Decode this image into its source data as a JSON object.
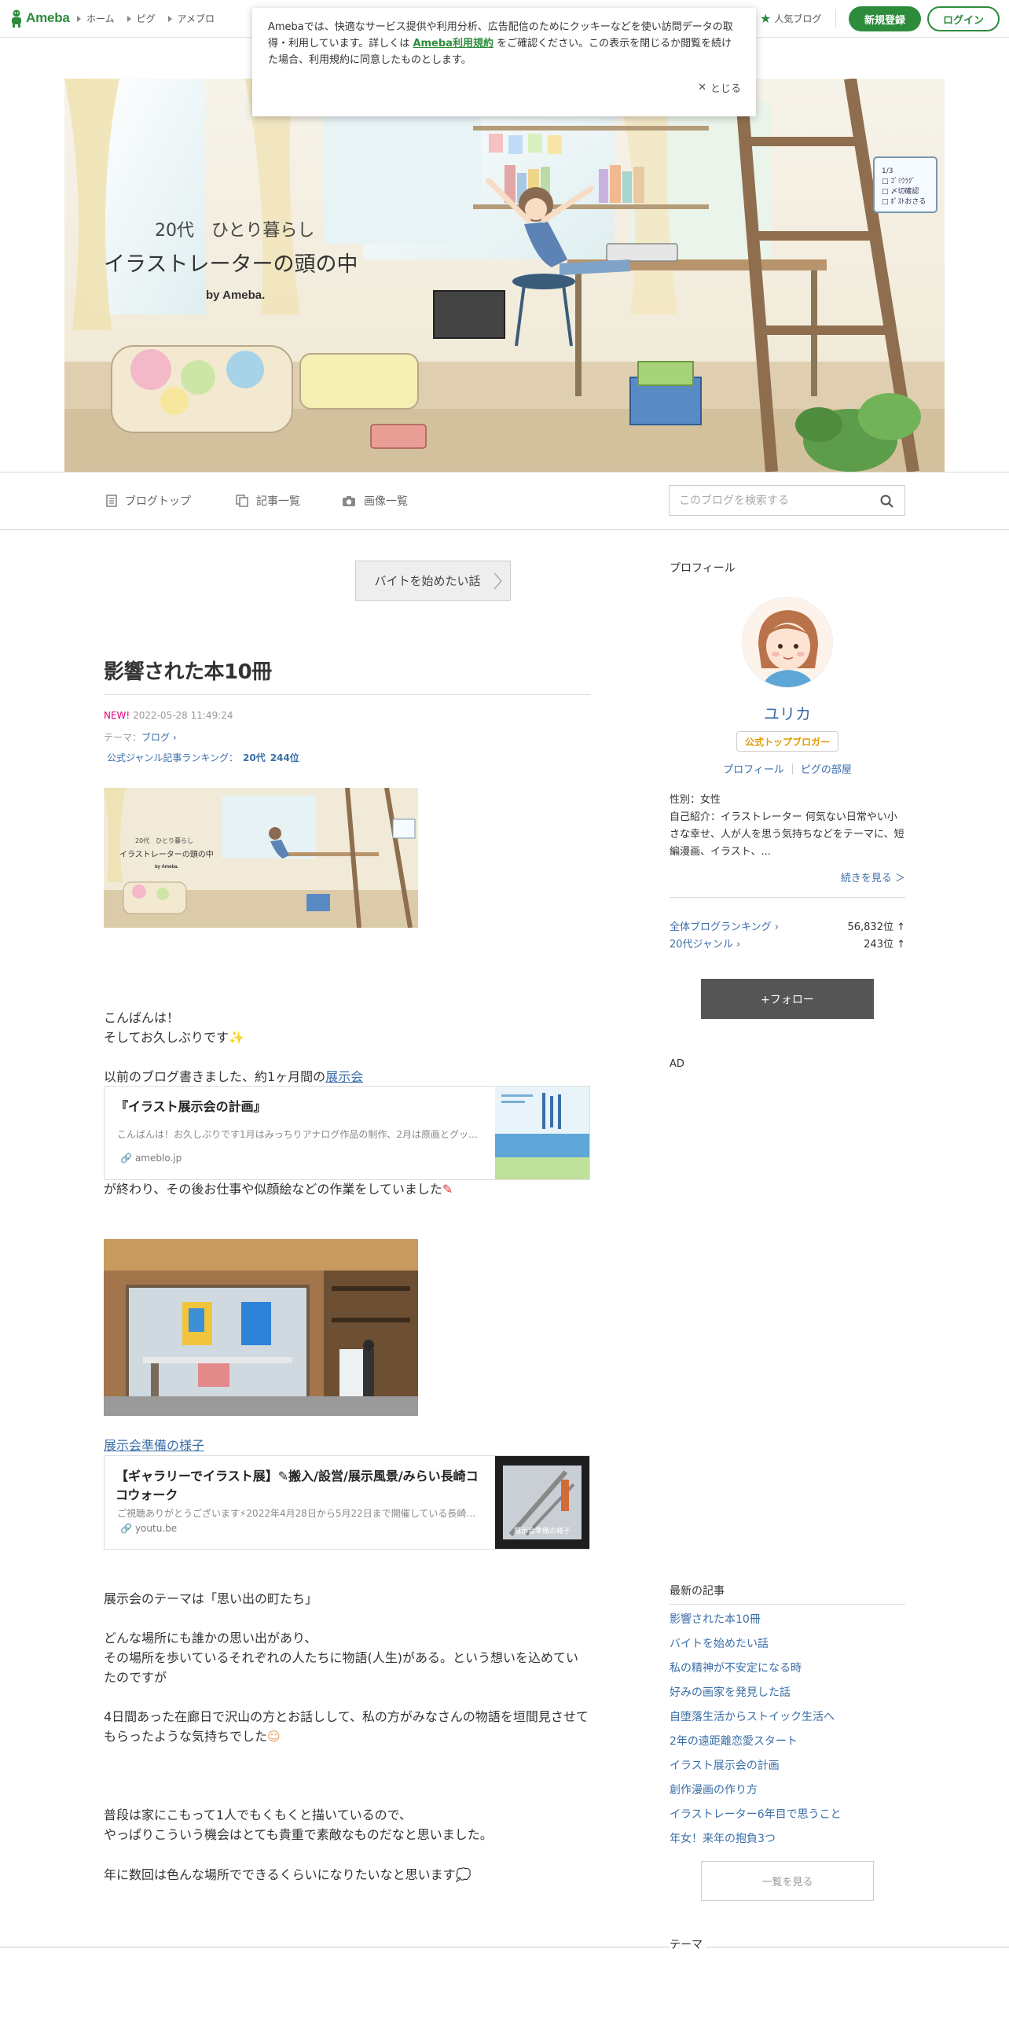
{
  "header": {
    "logo": "Ameba",
    "nav": [
      "ホーム",
      "ピグ",
      "アメブロ"
    ],
    "popular": "人気ブログ",
    "signup": "新規登録",
    "login": "ログイン"
  },
  "cookie": {
    "text_before": "Amebaでは、快適なサービス提供や利用分析、広告配信のためにクッキーなどを使い訪問データの取得・利用しています。詳しくは",
    "link": "Ameba利用規約",
    "text_after": "をご確認ください。この表示を閉じるか閲覧を続けた場合、利用規約に同意したものとします。",
    "close": "とじる"
  },
  "hero": {
    "line1": "20代　ひとり暮らし",
    "line2": "イラストレーターの頭の中",
    "byline": "by Ameba.",
    "memo": [
      "1/3",
      "□ ｺﾞﾐｳﾗｸﾞ",
      "□ 〆切確認",
      "□ ﾎﾟｽﾄおさる"
    ]
  },
  "blognav": {
    "top": "ブログトップ",
    "list": "記事一覧",
    "images": "画像一覧",
    "search_placeholder": "このブログを検索する"
  },
  "article": {
    "prev": "バイトを始めたい話",
    "title": "影響された本10冊",
    "new": "NEW!",
    "date": "2022-05-28 11:49:24",
    "theme_label": "テーマ：",
    "theme": "ブログ",
    "ranking_label": "公式ジャンル記事ランキング：",
    "ranking_genre": "20代",
    "ranking_rank": "244位",
    "p1a": "こんばんは！",
    "p1b": "そしてお久しぶりです",
    "p2": "以前のブログ書きました、約1ヶ月間の",
    "p2_link": "展示会",
    "card1": {
      "title": "『イラスト展示会の計画』",
      "desc": "こんばんは！お久しぶりです1月はみっちりアナログ作品の制作、2月は原画とグッ…",
      "domain": "ameblo.jp"
    },
    "p3": "が終わり、その後お仕事や似顔絵などの作業をしていました",
    "link2": "展示会準備の様子",
    "card2": {
      "title": "【ギャラリーでイラスト展】✎搬入/設営/展示風景/みらい長崎ココウォーク",
      "desc": "ご視聴ありがとうございます⚡2022年4月28日から5月22日まで開催している長崎…",
      "domain": "youtu.be",
      "thumb_text": "展示会準備の様子"
    },
    "p4": "展示会のテーマは「思い出の町たち」",
    "p5a": "どんな場所にも誰かの思い出があり、",
    "p5b": "その場所を歩いているそれぞれの人たちに物語(人生)がある。という想いを込めていたのですが",
    "p6": "4日間あった在廊日で沢山の方とお話しして、私の方がみなさんの物語を垣間見させてもらったような気持ちでした",
    "p7a": "普段は家にこもって1人でもくもくと描いているので、",
    "p7b": "やっぱりこういう機会はとても貴重で素敵なものだなと思いました。",
    "p8": "年に数回は色んな場所でできるくらいになりたいなと思います"
  },
  "sidebar": {
    "profile_h": "プロフィール",
    "name": "ユリカ",
    "badge": "公式トップブロガー",
    "link_profile": "プロフィール",
    "link_pig": "ピグの部屋",
    "gender": "性別：女性",
    "intro": "自己紹介：イラストレーター 何気ない日常やい小さな幸せ、人が人を思う気持ちなどをテーマに、短編漫画、イラスト、...",
    "more": "続きを見る ＞",
    "rank_all_label": "全体ブログランキング",
    "rank_all": "56,832位 ↑",
    "rank_genre_label": "20代ジャンル",
    "rank_genre": "243位 ↑",
    "follow": "+フォロー",
    "ad": "AD",
    "recent_h": "最新の記事",
    "recent": [
      "影響された本10冊",
      "バイトを始めたい話",
      "私の精神が不安定になる時",
      "好みの画家を発見した話",
      "自堕落生活からストイック生活へ",
      "2年の遠距離恋愛スタート",
      "イラスト展示会の計画",
      "創作漫画の作り方",
      "イラストレーター6年目で思うこと",
      "年女！来年の抱負3つ"
    ],
    "all": "一覧を見る",
    "theme_h": "テーマ"
  },
  "colors": {
    "brand": "#2d8c3c",
    "link": "#3a6ea8",
    "new": "#e4007f"
  }
}
